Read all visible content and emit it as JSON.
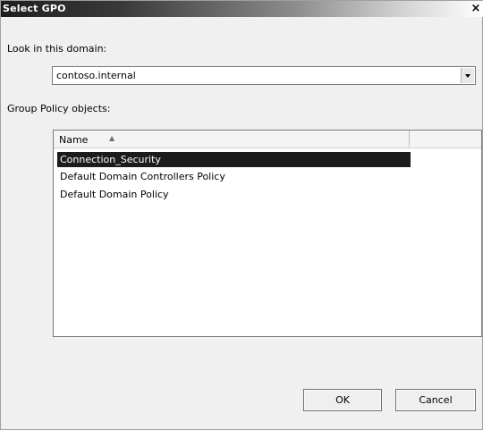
{
  "window": {
    "title": "Select GPO",
    "close_glyph": "×"
  },
  "domain": {
    "label": "Look in this domain:",
    "value": "contoso.internal"
  },
  "gpo_list": {
    "label": "Group Policy objects:",
    "column_name": "Name",
    "sort_indicator": "▲",
    "items": [
      {
        "name": "Connection_Security",
        "selected": true
      },
      {
        "name": "Default Domain Controllers Policy",
        "selected": false
      },
      {
        "name": "Default Domain Policy",
        "selected": false
      }
    ]
  },
  "buttons": {
    "ok": "OK",
    "cancel": "Cancel"
  }
}
